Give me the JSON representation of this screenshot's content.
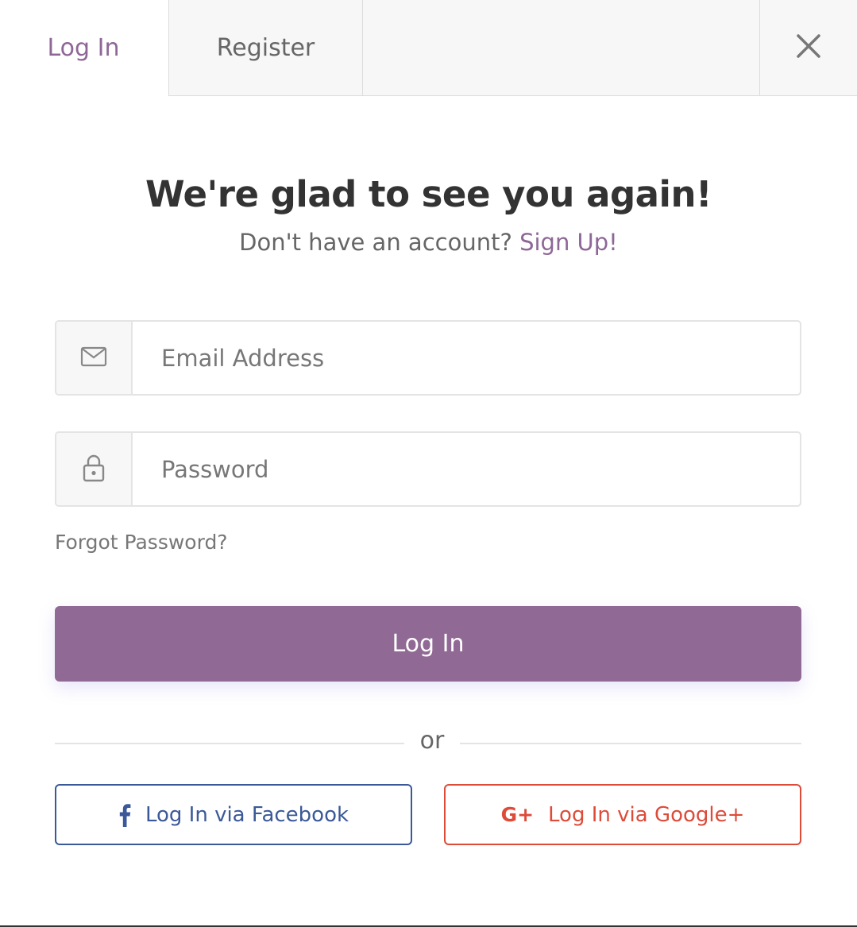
{
  "tabs": {
    "login_label": "Log In",
    "register_label": "Register"
  },
  "heading": {
    "title": "We're glad to see you again!",
    "prompt": "Don't have an account?",
    "signup_link": "Sign Up!"
  },
  "form": {
    "email_placeholder": "Email Address",
    "password_placeholder": "Password",
    "forgot_label": "Forgot Password?",
    "submit_label": "Log In"
  },
  "divider": {
    "label": "or"
  },
  "social": {
    "facebook_label": "Log In via Facebook",
    "google_label": "Log In via Google+",
    "google_icon_text": "G+"
  },
  "icons": {
    "email": "envelope-icon",
    "password": "lock-icon",
    "close": "close-icon",
    "facebook": "facebook-icon",
    "google": "google-plus-icon"
  },
  "colors": {
    "accent": "#8e6797",
    "button": "#916995",
    "facebook": "#3b5998",
    "google": "#dd4b39"
  }
}
